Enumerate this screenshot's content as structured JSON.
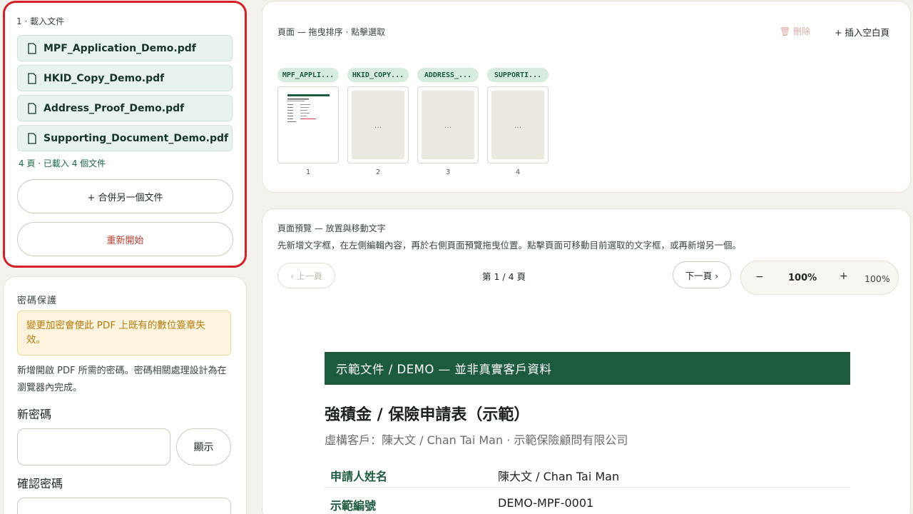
{
  "load": {
    "step_title": "1 · 載入文件",
    "files": [
      {
        "name": "MPF_Application_Demo.pdf"
      },
      {
        "name": "HKID_Copy_Demo.pdf"
      },
      {
        "name": "Address_Proof_Demo.pdf"
      },
      {
        "name": "Supporting_Document_Demo.pdf"
      }
    ],
    "summary": "4 頁 · 已載入 4 個文件",
    "merge_label": "+ 合併另一個文件",
    "restart_label": "重新開始"
  },
  "password": {
    "title": "密碼保護",
    "warning": "變更加密會使此 PDF 上既有的數位簽章失效。",
    "description": "新增開啟 PDF 所需的密碼。密碼相關處理設計為在瀏覽器內完成。",
    "new_label": "新密碼",
    "show_label": "顯示",
    "confirm_label": "確認密碼"
  },
  "pages": {
    "title": "頁面 — 拖曳排序 · 點擊選取",
    "delete_label": "🗑 刪除",
    "insert_label": "+ 插入空白頁",
    "thumbs": [
      {
        "tag": "MPF_APPLI...",
        "num": "1",
        "placeholder": ""
      },
      {
        "tag": "HKID_COPY...",
        "num": "2",
        "placeholder": "..."
      },
      {
        "tag": "ADDRESS_...",
        "num": "3",
        "placeholder": "..."
      },
      {
        "tag": "SUPPORTI...",
        "num": "4",
        "placeholder": "..."
      }
    ]
  },
  "preview": {
    "title": "頁面預覽 — 放置與移動文字",
    "description": "先新增文字框，在左側編輯內容，再於右側頁面預覽拖曳位置。點擊頁面可移動目前選取的文字框，或再新增另一個。",
    "prev_label": "‹ 上一頁",
    "page_indicator": "第 1 / 4 頁",
    "next_label": "下一頁 ›",
    "zoom_out": "−",
    "zoom_value": "100%",
    "zoom_in": "+",
    "zoom_label": "100%"
  },
  "document": {
    "banner": "示範文件 / DEMO — 並非真實客戶資料",
    "heading": "強積金 / 保險申請表（示範）",
    "subtitle": "虛構客戶：陳大文 / Chan Tai Man · 示範保險顧問有限公司",
    "rows": [
      {
        "key": "申請人姓名",
        "value": "陳大文 / Chan Tai Man"
      },
      {
        "key": "示範編號",
        "value": "DEMO-MPF-0001"
      }
    ]
  },
  "colors": {
    "accent": "#1d5b3f",
    "highlight_border": "#d61f26",
    "warning_text": "#b97a0f"
  }
}
